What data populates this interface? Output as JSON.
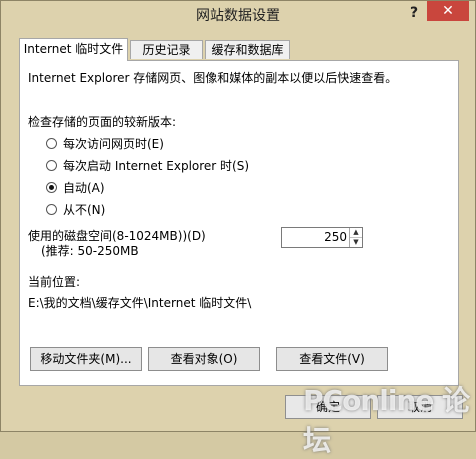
{
  "window": {
    "title": "网站数据设置",
    "help": "?",
    "close": "✕"
  },
  "tabs": [
    {
      "label": "Internet 临时文件",
      "active": true
    },
    {
      "label": "历史记录",
      "active": false
    },
    {
      "label": "缓存和数据库",
      "active": false
    }
  ],
  "panel": {
    "description": "Internet Explorer 存储网页、图像和媒体的副本以便以后快速查看。",
    "check_heading": "检查存储的页面的较新版本:",
    "radio_options": [
      {
        "label": "每次访问网页时(E)",
        "checked": false
      },
      {
        "label": "每次启动 Internet Explorer 时(S)",
        "checked": false
      },
      {
        "label": "自动(A)",
        "checked": true
      },
      {
        "label": "从不(N)",
        "checked": false
      }
    ],
    "disk_space_label": "使用的磁盘空间(8-1024MB))(D)",
    "disk_space_hint": "(推荐: 50-250MB",
    "disk_space_value": "250",
    "location_label": "当前位置:",
    "location_path": "E:\\我的文档\\缓存文件\\Internet 临时文件\\",
    "buttons": {
      "move_folder": "移动文件夹(M)...",
      "view_objects": "查看对象(O)",
      "view_files": "查看文件(V)"
    }
  },
  "footer": {
    "ok": "确定",
    "cancel": "取消"
  },
  "watermark": {
    "text": "PConline 论坛"
  },
  "colors": {
    "dialog_bg": "#ddd2ad",
    "close_button": "#c9463d",
    "panel_bg": "#ffffff"
  },
  "icons": {
    "help": "question-icon",
    "close": "close-icon",
    "spin_up": "spin-up-icon",
    "spin_down": "spin-down-icon"
  }
}
